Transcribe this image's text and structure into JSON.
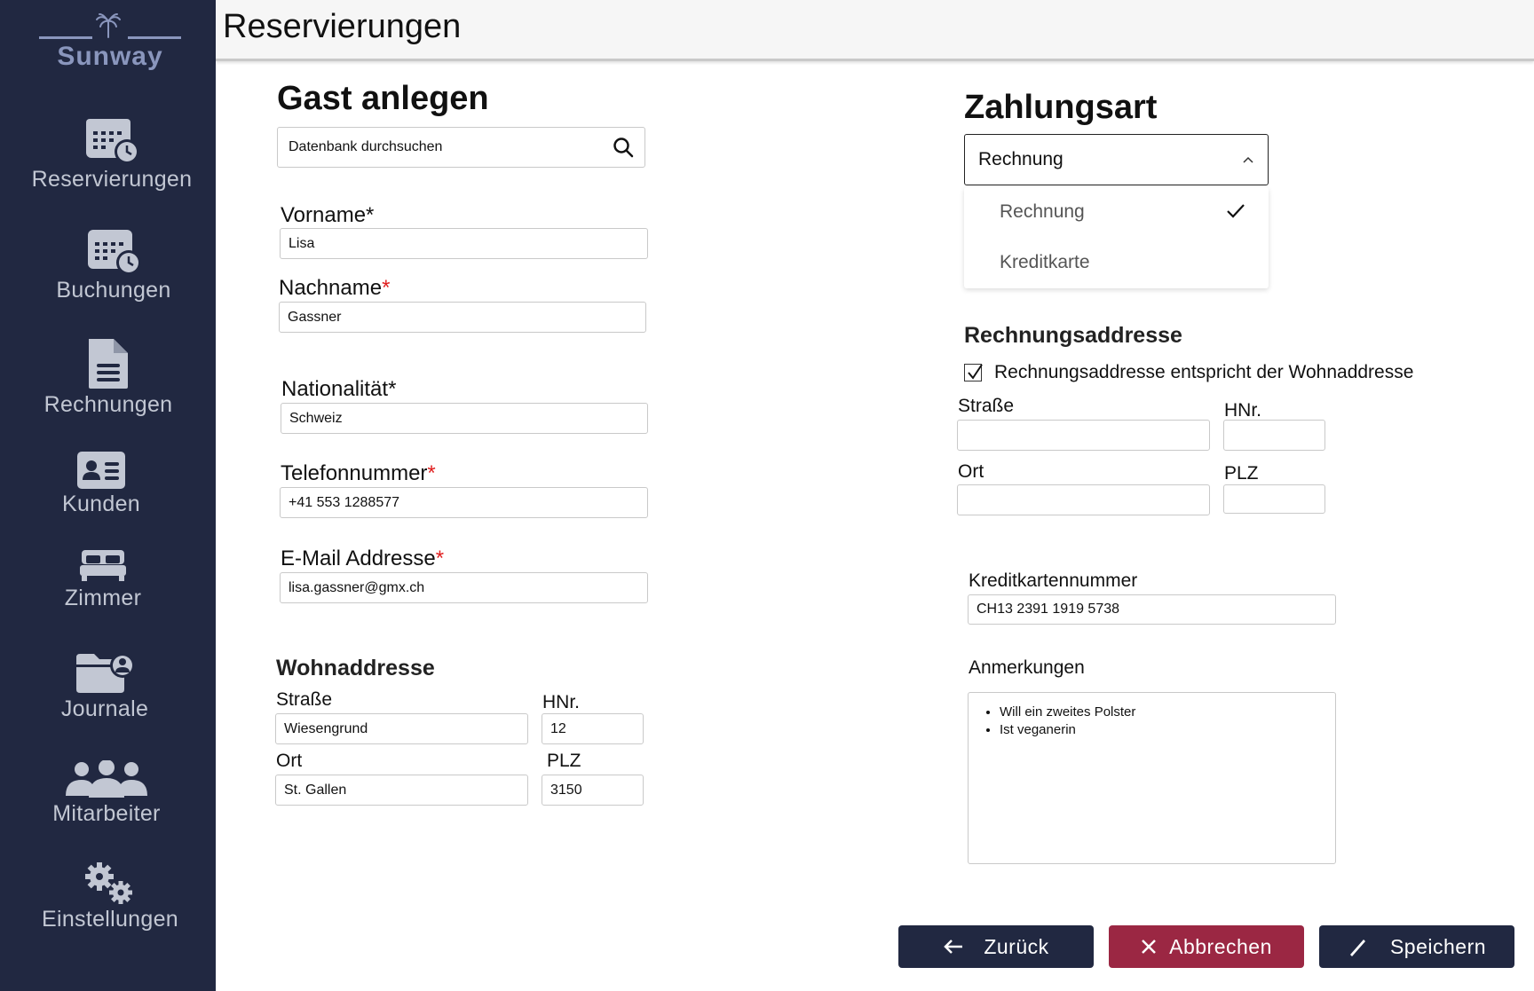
{
  "app": {
    "brand": "Sunway",
    "page_title": "Reservierungen"
  },
  "sidebar": {
    "items": [
      {
        "label": "Reservierungen",
        "icon": "calendar-clock-icon"
      },
      {
        "label": "Buchungen",
        "icon": "calendar-clock-icon"
      },
      {
        "label": "Rechnungen",
        "icon": "document-icon"
      },
      {
        "label": "Kunden",
        "icon": "id-card-icon"
      },
      {
        "label": "Zimmer",
        "icon": "bed-icon"
      },
      {
        "label": "Journale",
        "icon": "folder-user-icon"
      },
      {
        "label": "Mitarbeiter",
        "icon": "users-icon"
      },
      {
        "label": "Einstellungen",
        "icon": "gears-icon"
      }
    ]
  },
  "guest": {
    "heading": "Gast anlegen",
    "search": {
      "placeholder": "Datenbank durchsuchen"
    },
    "first_name": {
      "label": "Vorname*",
      "value": "Lisa"
    },
    "last_name": {
      "label": "Nachname",
      "value": "Gassner"
    },
    "nationality": {
      "label": "Nationalität*",
      "value": "Schweiz"
    },
    "phone": {
      "label": "Telefonnummer",
      "value": "+41 553 1288577"
    },
    "email": {
      "label": "E-Mail Addresse",
      "value": "lisa.gassner@gmx.ch"
    },
    "required_mark": "*"
  },
  "home_address": {
    "heading": "Wohnaddresse",
    "street": {
      "label": "Straße",
      "value": "Wiesengrund"
    },
    "house_no": {
      "label": "HNr.",
      "value": "12"
    },
    "city": {
      "label": "Ort",
      "value": "St. Gallen"
    },
    "zip": {
      "label": "PLZ",
      "value": "3150"
    }
  },
  "payment": {
    "heading": "Zahlungsart",
    "selected": "Rechnung",
    "options": [
      "Rechnung",
      "Kreditkarte"
    ]
  },
  "billing_address": {
    "heading": "Rechnungsaddresse",
    "same_as_home": {
      "label": "Rechnungsaddresse entspricht der Wohnaddresse",
      "checked": true
    },
    "street": {
      "label": "Straße",
      "value": ""
    },
    "house_no": {
      "label": "HNr.",
      "value": ""
    },
    "city": {
      "label": "Ort",
      "value": ""
    },
    "zip": {
      "label": "PLZ",
      "value": ""
    }
  },
  "credit_card": {
    "label": "Kreditkartennummer",
    "value": "CH13 2391 1919 5738"
  },
  "notes": {
    "label": "Anmerkungen",
    "items": [
      "Will ein zweites Polster",
      "Ist veganerin"
    ]
  },
  "actions": {
    "back": "Zurück",
    "cancel": "Abbrechen",
    "save": "Speichern"
  },
  "colors": {
    "sidebar_bg": "#212841",
    "accent_red": "#9b2743",
    "required": "#e01e1e",
    "logo": "#8a96bd"
  }
}
